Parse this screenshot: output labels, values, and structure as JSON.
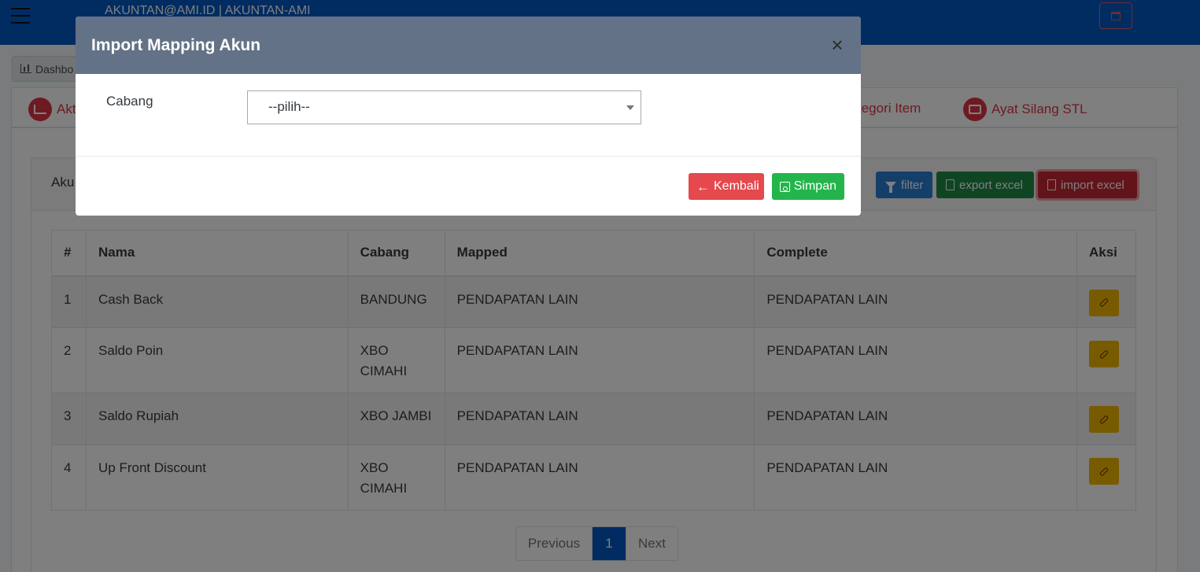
{
  "topbar": {
    "user_text": "AKUNTAN@AMI.ID | AKUNTAN-AMI",
    "menu_icon": "hamburger-icon",
    "right_icon": "window-icon"
  },
  "breadcrumb": {
    "label": "Dashbo"
  },
  "tabs": [
    {
      "label": "Akt",
      "icon": "chart-icon"
    },
    {
      "label": "tegori Item",
      "icon": ""
    },
    {
      "label": "Ayat Silang STL",
      "icon": "wallet-icon"
    }
  ],
  "card": {
    "title": "Aku",
    "buttons": {
      "filter": "filter",
      "export": "export excel",
      "import": "import excel"
    }
  },
  "table": {
    "headers": [
      "#",
      "Nama",
      "Cabang",
      "Mapped",
      "Complete",
      "Aksi"
    ],
    "rows": [
      {
        "no": "1",
        "nama": "Cash Back",
        "cabang": "BANDUNG",
        "mapped": "PENDAPATAN LAIN",
        "complete": "PENDAPATAN LAIN"
      },
      {
        "no": "2",
        "nama": "Saldo Poin",
        "cabang": "XBO CIMAHI",
        "mapped": "PENDAPATAN LAIN",
        "complete": "PENDAPATAN LAIN"
      },
      {
        "no": "3",
        "nama": "Saldo Rupiah",
        "cabang": "XBO JAMBI",
        "mapped": "PENDAPATAN LAIN",
        "complete": "PENDAPATAN LAIN"
      },
      {
        "no": "4",
        "nama": "Up Front Discount",
        "cabang": "XBO CIMAHI",
        "mapped": "PENDAPATAN LAIN",
        "complete": "PENDAPATAN LAIN"
      }
    ]
  },
  "pagination": {
    "previous": "Previous",
    "current": "1",
    "next": "Next"
  },
  "modal": {
    "title": "Import Mapping Akun",
    "close_symbol": "×",
    "field_label": "Cabang",
    "select_value": "--pilih--",
    "back_label": "Kembali",
    "save_label": "Simpan",
    "back_icon": "arrow-left-icon",
    "save_icon": "save-icon"
  },
  "colors": {
    "topbar": "#0059c2",
    "modal_header": "#637286",
    "danger": "#e5484d",
    "success": "#23b54c",
    "warning": "#f0b400"
  }
}
